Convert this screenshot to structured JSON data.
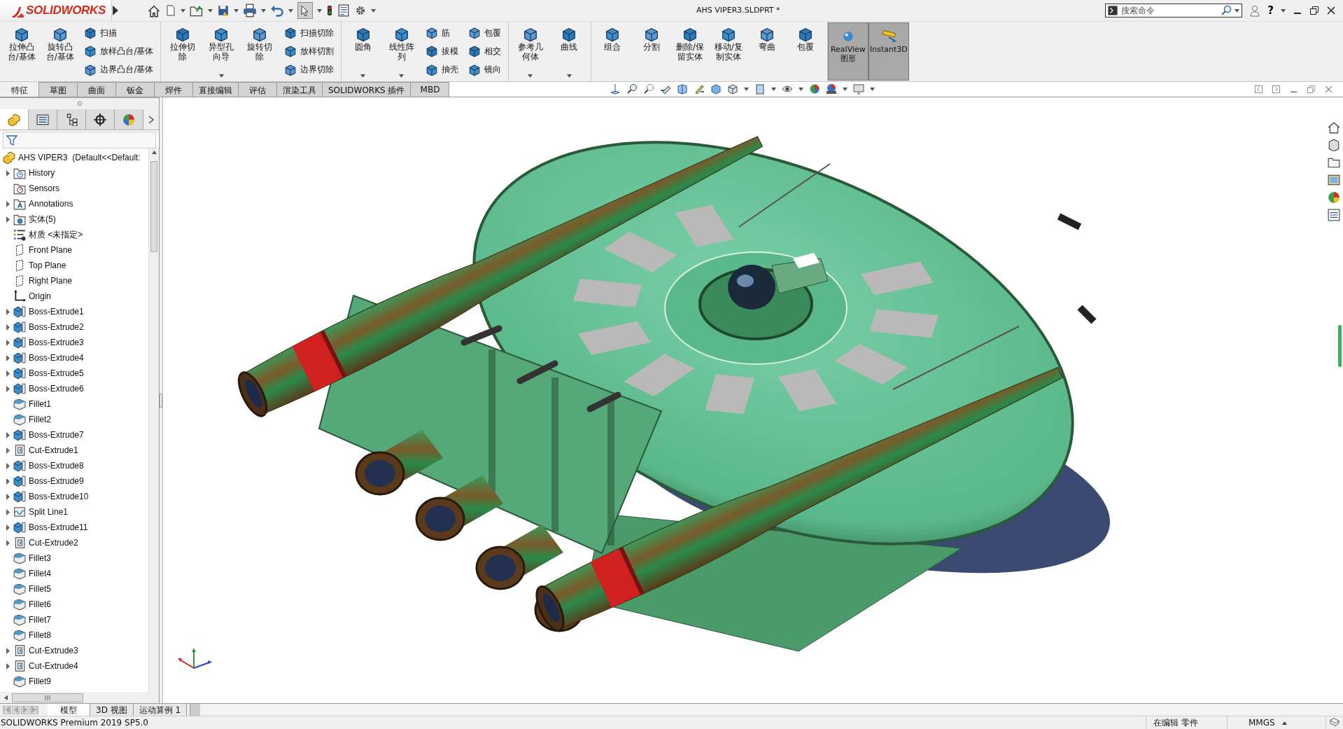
{
  "titlebar": {
    "logo": "SOLIDWORKS",
    "title": "AHS VIPER3.SLDPRT *",
    "search": {
      "placeholder": "搜索命令"
    },
    "help": "?"
  },
  "ribbon": {
    "groups": [
      {
        "buttons": [
          {
            "label": "拉伸凸台/基体",
            "dropdown": false
          },
          {
            "label": "旋转凸台/基体",
            "dropdown": false
          }
        ],
        "stacks": [
          [
            "扫描",
            "放样凸台/基体",
            "边界凸台/基体"
          ]
        ]
      },
      {
        "buttons": [
          {
            "label": "拉伸切除",
            "dropdown": false
          },
          {
            "label": "异型孔向导",
            "dropdown": true
          },
          {
            "label": "旋转切除",
            "dropdown": false
          }
        ],
        "stacks": [
          [
            "扫描切除",
            "放样切割",
            "边界切除"
          ]
        ]
      },
      {
        "buttons": [
          {
            "label": "圆角",
            "dropdown": true
          },
          {
            "label": "线性阵列",
            "dropdown": true
          }
        ],
        "stacks": [
          [
            "筋",
            "拔模",
            "抽壳"
          ],
          [
            "包覆",
            "相交",
            "镜向"
          ]
        ]
      },
      {
        "buttons": [
          {
            "label": "参考几何体",
            "dropdown": true
          },
          {
            "label": "曲线",
            "dropdown": true
          }
        ]
      },
      {
        "buttons": [
          {
            "label": "组合",
            "dropdown": false
          },
          {
            "label": "分割",
            "dropdown": false
          },
          {
            "label": "删除/保留实体",
            "dropdown": false
          },
          {
            "label": "移动/复制实体",
            "dropdown": false
          },
          {
            "label": "弯曲",
            "dropdown": false
          },
          {
            "label": "包覆",
            "dropdown": false
          }
        ]
      }
    ],
    "toggles": [
      {
        "label": "RealView\n图形",
        "pressed": true
      },
      {
        "label": "Instant3D",
        "pressed": true
      }
    ]
  },
  "command_tabs": [
    {
      "label": "特征",
      "selected": true
    },
    {
      "label": "草图",
      "selected": false
    },
    {
      "label": "曲面",
      "selected": false
    },
    {
      "label": "钣金",
      "selected": false
    },
    {
      "label": "焊件",
      "selected": false
    },
    {
      "label": "直接编辑",
      "selected": false
    },
    {
      "label": "评估",
      "selected": false
    },
    {
      "label": "渲染工具",
      "selected": false
    },
    {
      "label": "SOLIDWORKS 插件",
      "selected": false
    },
    {
      "label": "MBD",
      "selected": false
    }
  ],
  "panel_tabs": [
    {
      "kind": "features",
      "selected": true
    },
    {
      "kind": "properties",
      "selected": false
    },
    {
      "kind": "configurations",
      "selected": false
    },
    {
      "kind": "dimxpert",
      "selected": false
    },
    {
      "kind": "display",
      "selected": false
    }
  ],
  "feature_tree": {
    "root": "AHS VIPER3  (Default<<Default:",
    "items": [
      {
        "label": "History",
        "kind": "history",
        "expandable": true
      },
      {
        "label": "Sensors",
        "kind": "sensors",
        "expandable": false
      },
      {
        "label": "Annotations",
        "kind": "annotations",
        "expandable": true
      },
      {
        "label": "实体(5)",
        "kind": "bodies",
        "expandable": true
      },
      {
        "label": "材质 <未指定>",
        "kind": "material",
        "expandable": false
      },
      {
        "label": "Front Plane",
        "kind": "plane",
        "expandable": false
      },
      {
        "label": "Top Plane",
        "kind": "plane",
        "expandable": false
      },
      {
        "label": "Right Plane",
        "kind": "plane",
        "expandable": false
      },
      {
        "label": "Origin",
        "kind": "origin",
        "expandable": false
      },
      {
        "label": "Boss-Extrude1",
        "kind": "boss",
        "expandable": true
      },
      {
        "label": "Boss-Extrude2",
        "kind": "boss",
        "expandable": true
      },
      {
        "label": "Boss-Extrude3",
        "kind": "boss",
        "expandable": true
      },
      {
        "label": "Boss-Extrude4",
        "kind": "boss",
        "expandable": true
      },
      {
        "label": "Boss-Extrude5",
        "kind": "boss",
        "expandable": true
      },
      {
        "label": "Boss-Extrude6",
        "kind": "boss",
        "expandable": true
      },
      {
        "label": "Fillet1",
        "kind": "fillet",
        "expandable": false
      },
      {
        "label": "Fillet2",
        "kind": "fillet",
        "expandable": false
      },
      {
        "label": "Boss-Extrude7",
        "kind": "boss",
        "expandable": true
      },
      {
        "label": "Cut-Extrude1",
        "kind": "cut",
        "expandable": true
      },
      {
        "label": "Boss-Extrude8",
        "kind": "boss",
        "expandable": true
      },
      {
        "label": "Boss-Extrude9",
        "kind": "boss",
        "expandable": true
      },
      {
        "label": "Boss-Extrude10",
        "kind": "boss",
        "expandable": true
      },
      {
        "label": "Split Line1",
        "kind": "split",
        "expandable": true
      },
      {
        "label": "Boss-Extrude11",
        "kind": "boss",
        "expandable": true
      },
      {
        "label": "Cut-Extrude2",
        "kind": "cut",
        "expandable": true
      },
      {
        "label": "Fillet3",
        "kind": "fillet",
        "expandable": false
      },
      {
        "label": "Fillet4",
        "kind": "fillet",
        "expandable": false
      },
      {
        "label": "Fillet5",
        "kind": "fillet",
        "expandable": false
      },
      {
        "label": "Fillet6",
        "kind": "fillet",
        "expandable": false
      },
      {
        "label": "Fillet7",
        "kind": "fillet",
        "expandable": false
      },
      {
        "label": "Fillet8",
        "kind": "fillet",
        "expandable": false
      },
      {
        "label": "Cut-Extrude3",
        "kind": "cut",
        "expandable": true
      },
      {
        "label": "Cut-Extrude4",
        "kind": "cut",
        "expandable": true
      },
      {
        "label": "Fillet9",
        "kind": "fillet",
        "expandable": false
      }
    ]
  },
  "bottom_tabs": [
    {
      "label": "模型",
      "selected": true
    },
    {
      "label": "3D 视图",
      "selected": false
    },
    {
      "label": "运动算例 1",
      "selected": false
    }
  ],
  "status_bar": {
    "product": "SOLIDWORKS Premium 2019 SP5.0",
    "mode": "在编辑 零件",
    "units": "MMGS"
  }
}
